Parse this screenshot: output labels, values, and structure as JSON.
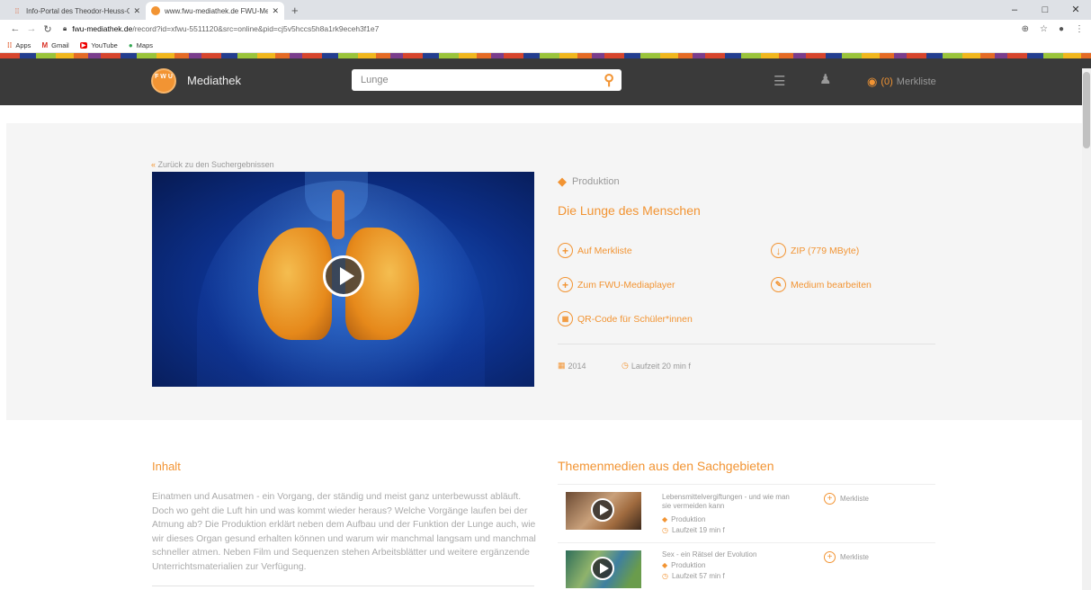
{
  "browser": {
    "tabs": [
      {
        "title": "Info-Portal des Theodor-Heuss-G",
        "icon": "grid-icon"
      },
      {
        "title": "www.fwu-mediathek.de FWU-Me",
        "icon": "fwu-icon"
      }
    ],
    "new_tab": "+",
    "window_controls": [
      "–",
      "□",
      "✕"
    ],
    "url_host": "fwu-mediathek.de",
    "url_path": "/record?id=xfwu-5511120&src=online&pid=cj5v5hccs5h8a1rk9eceh3f1e7",
    "bookmarks": [
      "Apps",
      "Gmail",
      "YouTube",
      "Maps"
    ]
  },
  "header": {
    "logo_text": "F W U",
    "brand": "Mediathek",
    "search_value": "Lunge",
    "merkliste_count": "(0)",
    "merkliste_label": "Merkliste"
  },
  "detail": {
    "back_link": "Zurück zu den Suchergebnissen",
    "type": "Produktion",
    "title": "Die Lunge des Menschen",
    "actions": {
      "merkliste": "Auf Merkliste",
      "zip": "ZIP (779 MByte)",
      "mediaplayer": "Zum FWU-Mediaplayer",
      "edit": "Medium bearbeiten",
      "qr": "QR-Code für Schüler*innen"
    },
    "year": "2014",
    "duration": "Laufzeit 20 min f"
  },
  "content": {
    "inhalt_heading": "Inhalt",
    "description": "Einatmen und Ausatmen - ein Vorgang, der ständig und meist ganz unterbewusst abläuft. Doch wo geht die Luft hin und was kommt wieder heraus? Welche Vorgänge laufen bei der Atmung ab? Die Produktion erklärt neben dem Aufbau und der Funktion der Lunge auch, wie wir dieses Organ gesund erhalten können und warum wir manchmal langsam und manchmal schneller atmen. Neben Film und Sequenzen stehen Arbeitsblätter und weitere ergänzende Unterrichtsmaterialien zur Verfügung.",
    "themen_heading": "Themenmedien aus den Sachgebieten",
    "related": [
      {
        "title": "Lebensmittelvergiftungen - und wie man sie vermeiden kann",
        "type": "Produktion",
        "duration": "Laufzeit 19 min f",
        "merk": "Merkliste"
      },
      {
        "title": "Sex - ein Rätsel der Evolution",
        "type": "Produktion",
        "duration": "Laufzeit 57 min f",
        "merk": "Merkliste"
      }
    ]
  },
  "colors": {
    "accent": "#f29433",
    "header_bg": "#3a3a3a",
    "detail_bg": "#f5f5f5"
  }
}
